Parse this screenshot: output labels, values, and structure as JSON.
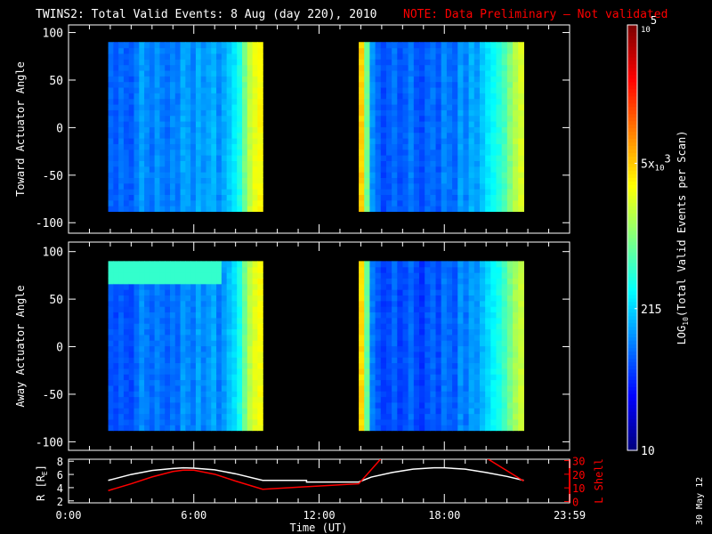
{
  "title": {
    "main": "TWINS2: Total Valid Events:  8 Aug (day 220), 2010",
    "note": "NOTE: Data Preliminary — Not validated"
  },
  "footer_date": "30 May 12",
  "colors": {
    "note": "#ff0000",
    "axes": "#ffffff",
    "lshell": "#ff0000",
    "radius": "#ffffff"
  },
  "chart_data": [
    {
      "type": "heatmap",
      "name": "toward",
      "ylabel": "Toward Actuator Angle",
      "ylim": [
        -111,
        108
      ],
      "yticks": [
        100,
        50,
        0,
        -50,
        -100
      ],
      "xlim": [
        0,
        24
      ],
      "blocks": [
        {
          "t0": 1.9,
          "t1": 9.3,
          "a0": -88,
          "a1": 90,
          "profile": [
            80,
            70,
            90,
            75,
            70,
            95,
            140,
            110,
            90,
            120,
            100,
            85,
            110,
            95,
            150,
            130,
            100,
            160,
            120,
            140,
            170,
            110,
            150,
            200,
            260,
            400,
            900,
            1800,
            2600,
            3200
          ]
        },
        {
          "t0": 13.9,
          "t1": 21.8,
          "a0": -88,
          "a1": 90,
          "profile": [
            5000,
            900,
            120,
            80,
            60,
            70,
            90,
            65,
            75,
            100,
            70,
            60,
            80,
            90,
            70,
            110,
            90,
            80,
            140,
            100,
            160,
            130,
            190,
            260,
            330,
            420,
            600,
            1000,
            1600,
            2200
          ]
        }
      ]
    },
    {
      "type": "heatmap",
      "name": "away",
      "ylabel": "Away Actuator Angle",
      "ylim": [
        -109,
        110
      ],
      "yticks": [
        100,
        50,
        0,
        -50,
        -100
      ],
      "xlim": [
        0,
        24
      ],
      "blocks": [
        {
          "t0": 1.9,
          "t1": 9.3,
          "a0": -88,
          "a1": 90,
          "profile": [
            70,
            60,
            75,
            65,
            60,
            80,
            120,
            95,
            80,
            100,
            85,
            75,
            95,
            80,
            130,
            110,
            90,
            140,
            100,
            120,
            150,
            95,
            130,
            180,
            240,
            380,
            850,
            1700,
            2400,
            3000
          ],
          "stripe": {
            "a0": 72,
            "a1": 88,
            "value": 500
          }
        },
        {
          "t0": 13.9,
          "t1": 21.8,
          "a0": -88,
          "a1": 90,
          "profile": [
            4500,
            800,
            100,
            70,
            55,
            60,
            80,
            55,
            65,
            85,
            60,
            50,
            70,
            80,
            60,
            95,
            80,
            70,
            120,
            90,
            140,
            120,
            170,
            230,
            300,
            380,
            550,
            900,
            1400,
            1900
          ]
        }
      ]
    },
    {
      "type": "line",
      "name": "ephemeris",
      "xlabel": "Time (UT)",
      "xticks": [
        "0:00",
        "6:00",
        "12:00",
        "18:00",
        "23:59"
      ],
      "xtick_values": [
        0,
        6,
        12,
        18,
        24
      ],
      "ylabel_left": "R [R",
      "ylabel_left_sub": "E",
      "ylabel_left_end": "]",
      "ylim_left": [
        1.7,
        8.3
      ],
      "yticks_left": [
        "8",
        "6",
        "4",
        "2"
      ],
      "ylabel_right": "L Shell",
      "ylim_right": [
        -1,
        31
      ],
      "yticks_right": [
        "30",
        "20",
        "10",
        "0"
      ],
      "series": [
        {
          "name": "R",
          "axis": "left",
          "x": [
            1.9,
            3,
            4,
            5,
            5.5,
            6,
            7,
            8,
            9.3,
            11.4,
            11.4,
            13.9,
            14.5,
            15.5,
            16.5,
            17.5,
            18,
            19,
            20,
            21,
            21.8
          ],
          "y": [
            5.1,
            6.0,
            6.6,
            6.9,
            7.0,
            6.95,
            6.7,
            6.1,
            5.1,
            5.1,
            4.85,
            4.85,
            5.6,
            6.3,
            6.8,
            7.0,
            7.0,
            6.8,
            6.3,
            5.7,
            5.1
          ]
        },
        {
          "name": "L",
          "axis": "right",
          "x": [
            1.9,
            3,
            4,
            5,
            5.5,
            6,
            7,
            8,
            9.3,
            11,
            13.9,
            15.0
          ],
          "y": [
            8,
            13,
            18,
            22,
            23,
            23,
            20,
            15,
            9,
            10.5,
            13,
            32
          ]
        },
        {
          "name": "L2",
          "axis": "right",
          "x": [
            20.0,
            21.8
          ],
          "y": [
            32,
            15
          ]
        }
      ]
    },
    {
      "type": "colorbar",
      "label": "LOG",
      "label_sub": "10",
      "label_end": "(Total Valid  Events  per Scan)",
      "range": [
        10,
        100000
      ],
      "ticks": [
        {
          "value": 100000,
          "base": "10",
          "exp": "5",
          "prefix": ""
        },
        {
          "value": 5000,
          "base": "10",
          "exp": "3",
          "prefix": "5x"
        },
        {
          "value": 215,
          "text": "215"
        },
        {
          "value": 10,
          "text": "10"
        }
      ]
    }
  ]
}
